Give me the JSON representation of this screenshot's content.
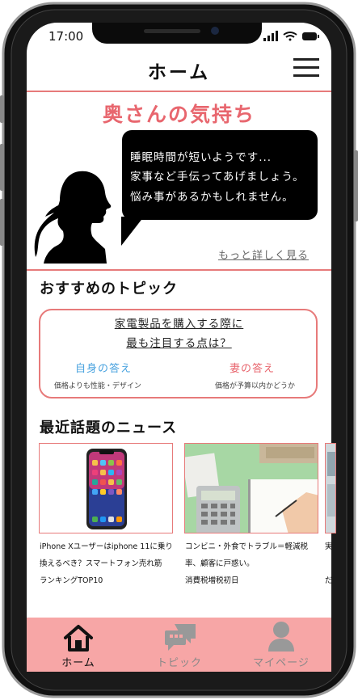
{
  "status": {
    "time": "17:00"
  },
  "header": {
    "title": "ホーム"
  },
  "feeling": {
    "heading": "奥さんの気持ち",
    "lines": [
      "睡眠時間が短いようです...",
      "家事など手伝ってあげましょう。",
      "悩み事があるかもしれません。"
    ],
    "more_link": "もっと詳しく見る"
  },
  "topics": {
    "heading": "おすすめのトピック",
    "question_lines": [
      "家電製品を購入する際に",
      "最も注目する点は？"
    ],
    "self_answer": {
      "label": "自身の答え",
      "detail": "価格よりも性能・デザイン",
      "color": "#4aa3df"
    },
    "wife_answer": {
      "label": "妻の答え",
      "detail": "価格が予算以内かどうか",
      "color": "#e8666e"
    }
  },
  "news": {
    "heading": "最近話題のニュース",
    "items": [
      {
        "lines": [
          "iPhone Xユーザーはiphone 11に乗り",
          "換えるべき？スマートフォン売れ筋",
          "ランキングTOP10"
        ]
      },
      {
        "lines": [
          "コンビニ・外食でトラブル＝軽減税",
          "率、顧客に戸惑い。",
          "消費税増税初日"
        ]
      },
      {
        "lines": [
          "実",
          "",
          "だ"
        ]
      }
    ]
  },
  "tabbar": {
    "items": [
      {
        "label": "ホーム",
        "icon": "home-icon",
        "active": true
      },
      {
        "label": "トピック",
        "icon": "chat-bubbles-icon",
        "active": false
      },
      {
        "label": "マイページ",
        "icon": "person-icon",
        "active": false
      }
    ]
  },
  "colors": {
    "accent": "#e8666e",
    "tabbar": "#f7a6a6",
    "blue": "#4aa3df"
  }
}
